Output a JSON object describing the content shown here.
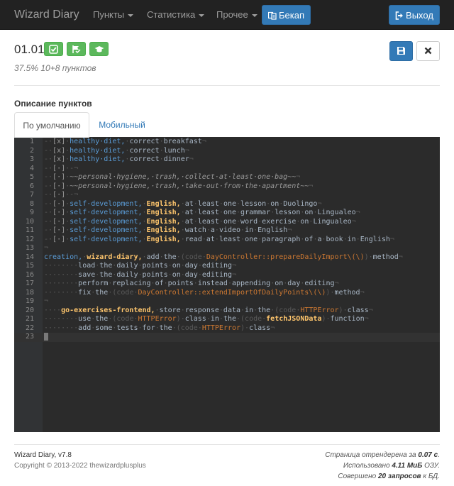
{
  "navbar": {
    "brand": "Wizard Diary",
    "menus": [
      "Пункты",
      "Статистика",
      "Прочее"
    ],
    "backup_label": "Бекап",
    "logout_label": "Выход"
  },
  "header": {
    "title": "01.01",
    "subtitle": "37.5% 10+8 пунктов"
  },
  "section": {
    "label": "Описание пунктов",
    "tabs": [
      "По умолчанию",
      "Мобильный"
    ]
  },
  "editor": {
    "line_numbers": [
      "1",
      "2",
      "3",
      "4",
      "5",
      "6",
      "7",
      "8",
      "9",
      "10",
      "11",
      "12",
      "13",
      "14",
      "15",
      "16",
      "17",
      "18",
      "19",
      "20",
      "21",
      "22",
      "23"
    ],
    "active_line": "23"
  },
  "footer": {
    "version": "Wizard Diary, v7.8",
    "copyright": "Copyright © 2013-2022 thewizardplusplus",
    "render_prefix": "Страница отрендерена за",
    "render_time": "0.07 с",
    "memory_prefix": "Использовано",
    "memory": "4.11 МиБ",
    "memory_suffix": "ОЗУ.",
    "queries_prefix": "Совершено",
    "queries": "20 запросов",
    "queries_suffix": "к БД."
  },
  "colors": {
    "navbar_bg": "#222222",
    "primary": "#337ab7",
    "success": "#5cb85c",
    "editor_bg": "#2b2b2b"
  },
  "icons": [
    "check-square-icon",
    "flag-icon",
    "graduation-cap-icon",
    "save-icon",
    "close-icon",
    "backup-icon",
    "logout-icon"
  ]
}
